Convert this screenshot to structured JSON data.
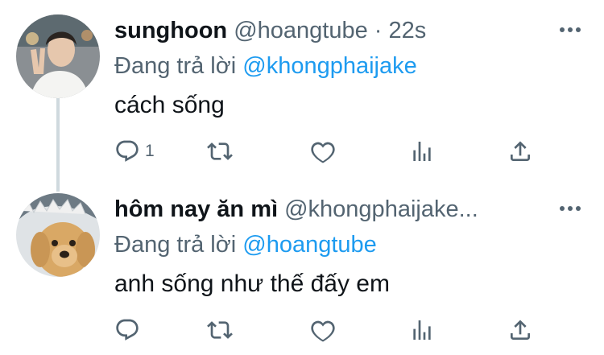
{
  "tweets": [
    {
      "name": "sunghoon",
      "handle": "@hoangtube",
      "separator": "·",
      "time": "22s",
      "reply_prefix": "Đang trả lời",
      "reply_mention": "@khongphaijake",
      "text": "cách sống",
      "reply_count": "1",
      "retweet_count": "",
      "like_count": "",
      "icons": [
        "reply-icon",
        "retweet-icon",
        "like-icon",
        "analytics-icon",
        "share-icon",
        "more-icon"
      ]
    },
    {
      "name": "hôm nay ăn mì",
      "handle": "@khongphaijake...",
      "separator": "",
      "time": "",
      "reply_prefix": "Đang trả lời",
      "reply_mention": "@hoangtube",
      "text": "anh sống như thế đấy em",
      "reply_count": "",
      "retweet_count": "",
      "like_count": "",
      "icons": [
        "reply-icon",
        "retweet-icon",
        "like-icon",
        "analytics-icon",
        "share-icon",
        "more-icon"
      ]
    }
  ],
  "colors": {
    "text_primary": "#0f1419",
    "text_secondary": "#536471",
    "mention": "#1d9bf0",
    "thread_line": "#cfd9de"
  }
}
